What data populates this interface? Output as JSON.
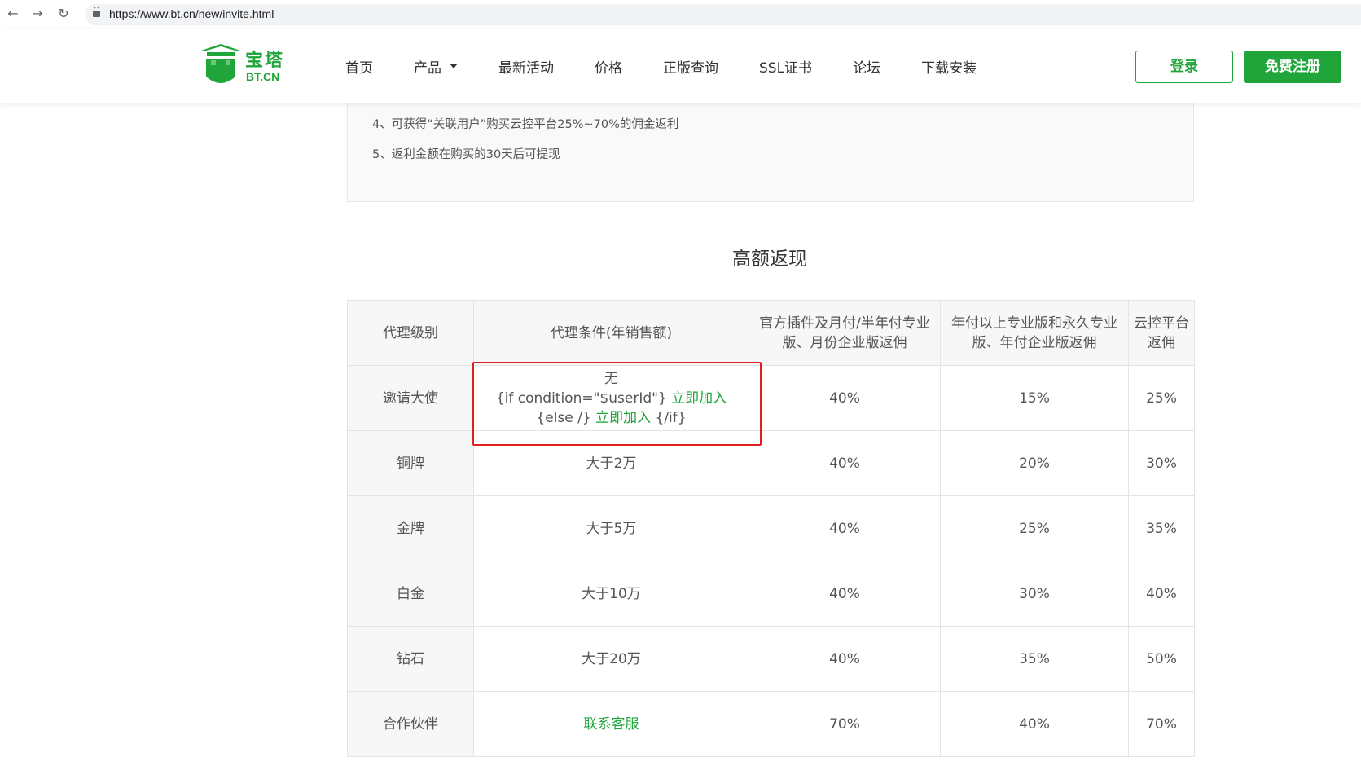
{
  "browser": {
    "url": "https://www.bt.cn/new/invite.html",
    "back_glyph": "←",
    "forward_glyph": "→",
    "reload_glyph": "↻"
  },
  "header": {
    "logo_cn": "宝塔",
    "logo_en": "BT.CN",
    "nav": [
      {
        "label": "首页"
      },
      {
        "label": "产品",
        "has_dropdown": true
      },
      {
        "label": "最新活动"
      },
      {
        "label": "价格"
      },
      {
        "label": "正版查询"
      },
      {
        "label": "SSL证书"
      },
      {
        "label": "论坛"
      },
      {
        "label": "下载安装"
      }
    ],
    "login_label": "登录",
    "register_label": "免费注册"
  },
  "rules": {
    "items": [
      "4、可获得“关联用户”购买云控平台25%~70%的佣金返利",
      "5、返利金额在购买的30天后可提现"
    ]
  },
  "section": {
    "title": "高额返现"
  },
  "table": {
    "headers": [
      "代理级别",
      "代理条件(年销售额)",
      "官方插件及月付/半年付专业版、月份企业版返佣",
      "年付以上专业版和永久专业版、年付企业版返佣",
      "云控平台返佣"
    ],
    "rows": [
      {
        "level": "邀请大使",
        "cond_line1": "无",
        "cond_part1": "{if condition=\"$userId\"} ",
        "cond_link1": "立即加入",
        "cond_part2": " {else /} ",
        "cond_link2": "立即加入",
        "cond_part3": " {/if}",
        "r1": "40%",
        "r2": "15%",
        "r3": "25%"
      },
      {
        "level": "铜牌",
        "cond": "大于2万",
        "r1": "40%",
        "r2": "20%",
        "r3": "30%"
      },
      {
        "level": "金牌",
        "cond": "大于5万",
        "r1": "40%",
        "r2": "25%",
        "r3": "35%"
      },
      {
        "level": "白金",
        "cond": "大于10万",
        "r1": "40%",
        "r2": "30%",
        "r3": "40%"
      },
      {
        "level": "钻石",
        "cond": "大于20万",
        "r1": "40%",
        "r2": "35%",
        "r3": "50%"
      },
      {
        "level": "合作伙伴",
        "cond_link": "联系客服",
        "r1": "70%",
        "r2": "40%",
        "r3": "70%"
      }
    ]
  },
  "colors": {
    "brand_green": "#20a53a",
    "highlight_red": "#e02020"
  }
}
